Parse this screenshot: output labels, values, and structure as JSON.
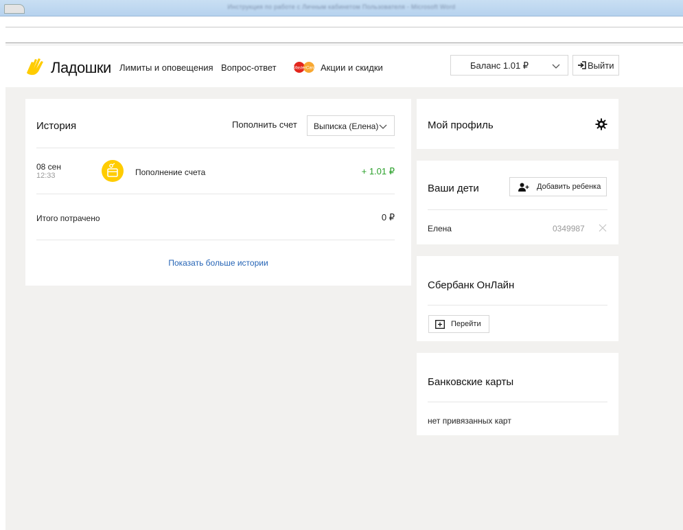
{
  "header": {
    "logo_text": "Ладошки",
    "nav": [
      "Лимиты и оповещения",
      "Вопрос-ответ",
      "Акции и скидки"
    ],
    "mastercard_badge": "MasterCard",
    "balance": "Баланс 1.01 ₽",
    "logout": "Выйти"
  },
  "history": {
    "title": "История",
    "topup": "Пополнить счет",
    "statement": "Выписка (Елена)",
    "transactions": [
      {
        "date": "08 сен",
        "time": "12:33",
        "description": "Пополнение счета",
        "amount": "+ 1.01 ₽"
      }
    ],
    "total_label": "Итого потрачено",
    "total_value": "0 ₽",
    "more": "Показать больше истории"
  },
  "profile": {
    "title": "Мой профиль"
  },
  "children": {
    "title": "Ваши дети",
    "add": "Добавить ребенка",
    "items": [
      {
        "name": "Елена",
        "id": "0349987"
      }
    ]
  },
  "sberbank": {
    "title": "Сбербанк ОнЛайн",
    "go": "Перейти"
  },
  "bank_cards": {
    "title": "Банковские карты",
    "empty": "нет привязанных карт"
  },
  "colors": {
    "accent_yellow": "#ffcc00",
    "amount_green": "#2aa02a",
    "link_blue": "#2463b5",
    "page_bg": "#f2f1ef"
  },
  "icons": [
    "hand-logo-icon",
    "mastercard-icon",
    "chevron-down-icon",
    "logout-icon",
    "wallet-icon",
    "gear-icon",
    "add-user-icon",
    "close-icon",
    "plus-box-icon"
  ]
}
